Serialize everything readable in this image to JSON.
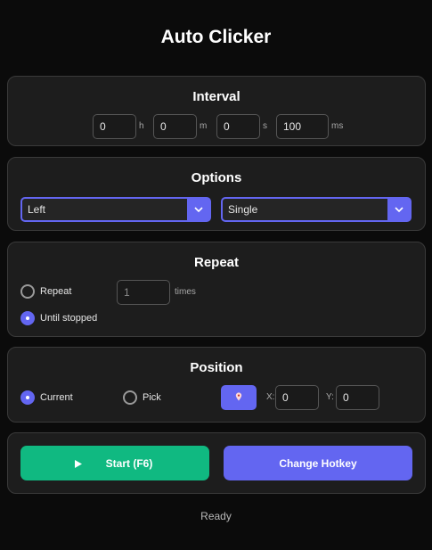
{
  "app": {
    "title": "Auto Clicker",
    "status": "Ready"
  },
  "interval": {
    "title": "Interval",
    "hours": {
      "value": "0",
      "unit": "h"
    },
    "minutes": {
      "value": "0",
      "unit": "m"
    },
    "seconds": {
      "value": "0",
      "unit": "s"
    },
    "milliseconds": {
      "value": "100",
      "unit": "ms"
    }
  },
  "options": {
    "title": "Options",
    "mouse_button": "Left",
    "click_type": "Single"
  },
  "repeat": {
    "title": "Repeat",
    "repeat_label": "Repeat",
    "repeat_count_placeholder": "1",
    "times_label": "times",
    "until_stopped_label": "Until stopped",
    "selected": "until_stopped"
  },
  "position": {
    "title": "Position",
    "current_label": "Current",
    "pick_label": "Pick",
    "pick_icon": "location-pin-icon",
    "x_label": "X:",
    "x_value": "0",
    "y_label": "Y:",
    "y_value": "0",
    "selected": "current"
  },
  "actions": {
    "start_icon": "play-icon",
    "start_label": "Start (F6)",
    "hotkey_label": "Change Hotkey"
  },
  "colors": {
    "accent": "#6366f1",
    "start": "#10b981",
    "background": "#0b0b0b",
    "panel": "#1d1d1d"
  }
}
